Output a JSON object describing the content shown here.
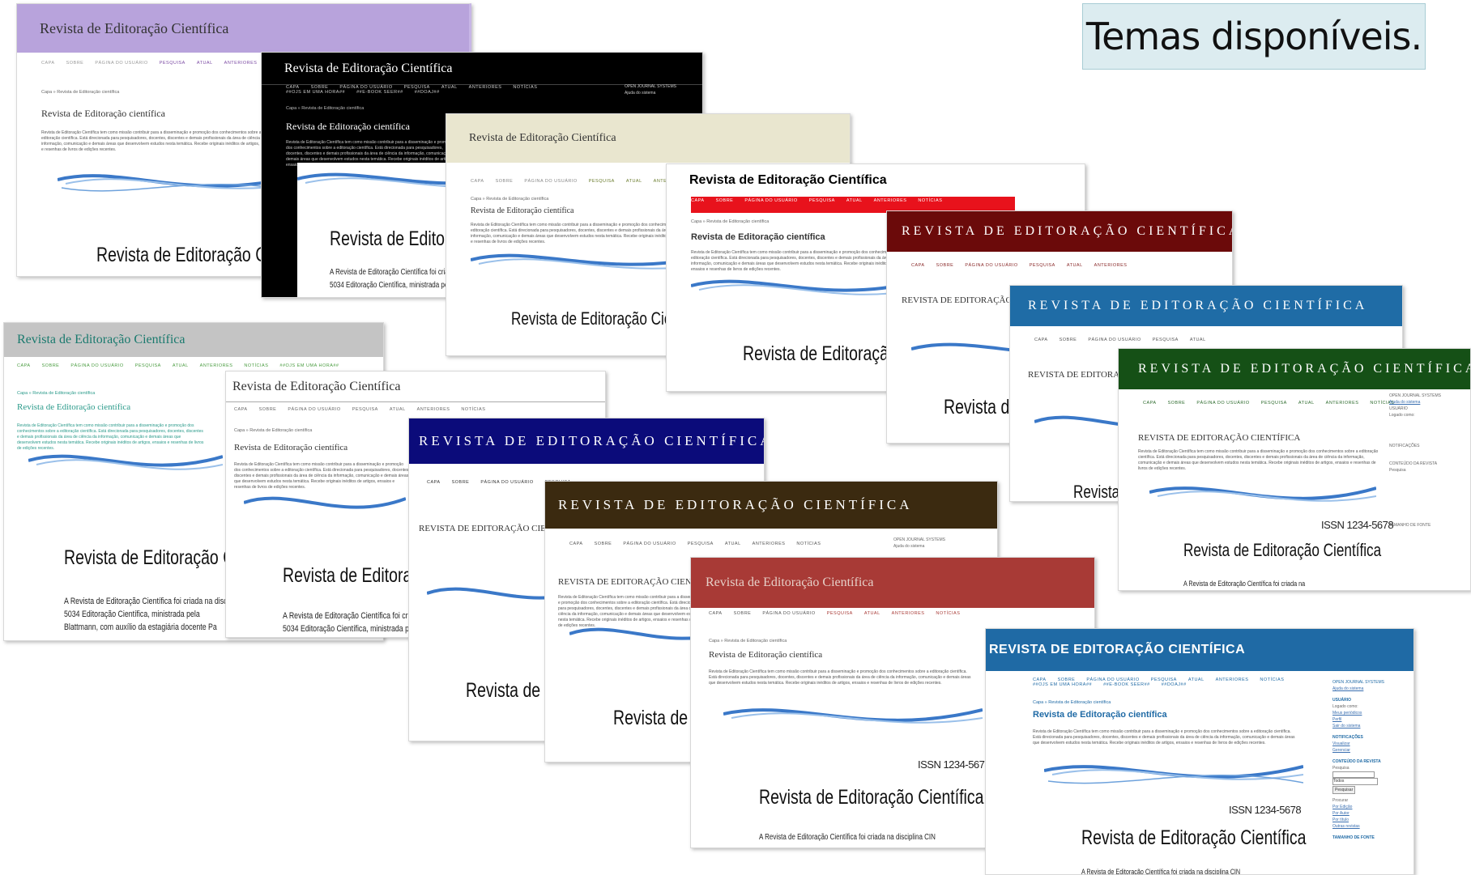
{
  "caption": "Temas disponíveis.",
  "journal": {
    "title": "Revista de Editoração Científica",
    "title_caps": "REVISTA DE EDITORAÇÃO CIENTÍFICA",
    "title_caps_short": "REVISTA DE EDITORAÇÃO CIENTÍFICA",
    "title_small": "Revista de Editoração científica",
    "title_small_caps": "REVISTA DE EDITORAÇÃO CIENTÍFICA",
    "big_title": "Revista de Editoração Científica",
    "issn": "ISSN 1234-5678",
    "crumb": "Capa » Revista de Editoração científica",
    "desc": "Revista de Editoração Científica tem como missão contribuir para a disseminação e promoção dos conhecimentos sobre a editoração científica. Está direcionada para pesquisadores, docentes, discentes e demais profissionais da área de ciência da informação, comunicação e demais áreas que desenvolvem estudos nesta temática. Recebe originais inéditos de artigos, ensaios e resenhas de livros de edições recentes.",
    "intro_1": "A Revista de Editoração Científica foi criada na disciplina CIN",
    "intro_2": "5034 Editoração Científica, ministrada pela",
    "intro_3": "Blattmann, com auxílio da estagiária docente Pa",
    "intro_short": "A Revista de Editoração Científica foi criada na",
    "ojs": "OPEN JOURNAL SYSTEMS",
    "help": "Ajuda do sistema",
    "user": "USUÁRIO",
    "logged": "Logado como:",
    "user_links": [
      "Meus periódicos",
      "Perfil",
      "Sair do sistema"
    ],
    "notif": "NOTIFICAÇÕES",
    "notif_links": [
      "Visualizar",
      "Gerenciar"
    ],
    "content": "CONTEÚDO DA REVISTA",
    "search": "Pesquisa",
    "all": "Todos",
    "search_btn": "Pesquisar",
    "browse": "Procurar",
    "browse_links": [
      "Por Edição",
      "Por Autor",
      "Por título",
      "Outras revistas"
    ],
    "font": "TAMANHO DE FONTE"
  },
  "nav_items": [
    "CAPA",
    "SOBRE",
    "PÁGINA DO USUÁRIO",
    "PESQUISA",
    "ATUAL",
    "ANTERIORES",
    "NOTÍCIAS",
    "##OJS EM UMA HORA##",
    "##E-BOOK SEER##",
    "##DOAJ##"
  ],
  "themes": {
    "lilac": "#b8a3dc",
    "black": "#050505",
    "beige": "#e9e6cf",
    "red": "#e8121c",
    "maroon": "#6b0a0a",
    "steelblue": "#1f6ca6",
    "darkgreen": "#155016",
    "gray": "#c4c4c4",
    "navy": "#0b0b7a",
    "brown": "#3b2a10",
    "brick": "#a83a36",
    "blue": "#1f6aa5"
  }
}
